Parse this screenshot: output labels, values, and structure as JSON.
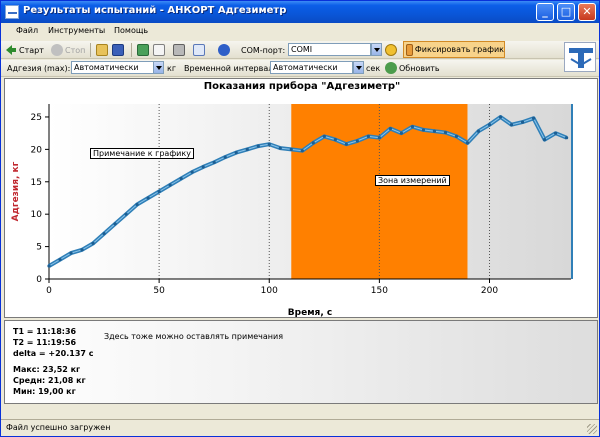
{
  "window": {
    "title": "Результаты испытаний - АНКОРТ Адгезиметр",
    "minimize": "_",
    "maximize": "□",
    "close": "✕"
  },
  "menu": [
    "Файл",
    "Инструменты",
    "Помощь"
  ],
  "toolbar": {
    "start_label": "Старт",
    "stop_label": "Стоп",
    "com_port_label": "COM-порт:",
    "com_port_value": "COMI",
    "fix_graph_label": "Фиксировать график"
  },
  "toolbar2": {
    "adhesion_label": "Адгезия (max):",
    "adhesion_value": "Автоматически",
    "adhesion_unit": "кг",
    "interval_label": "Временной интервал:",
    "interval_value": "Автоматически",
    "interval_unit": "сек",
    "refresh_label": "Обновить"
  },
  "chart": {
    "title": "Показания прибора \"Адгезиметр\"",
    "note_label": "Примечание к графику",
    "zone_label": "Зона измерений"
  },
  "chart_data": {
    "type": "line",
    "xlabel": "Время, с",
    "ylabel": "Адгезия, кг",
    "xlim": [
      0,
      237
    ],
    "ylim": [
      0,
      27
    ],
    "x_ticks": [
      0,
      50,
      100,
      150,
      200
    ],
    "y_ticks": [
      0,
      5,
      10,
      15,
      20,
      25
    ],
    "highlight_range": [
      110,
      190
    ],
    "series": [
      {
        "x": [
          0,
          5,
          10,
          15,
          20,
          25,
          30,
          35,
          40,
          45,
          50,
          55,
          60,
          65,
          70,
          75,
          80,
          85,
          90,
          95,
          100,
          105,
          110,
          115,
          120,
          125,
          130,
          135,
          140,
          145,
          150,
          155,
          160,
          165,
          170,
          175,
          180,
          185,
          190,
          195,
          200,
          205,
          210,
          215,
          220,
          225,
          230,
          235
        ],
        "values": [
          2.0,
          3.0,
          4.0,
          4.5,
          5.5,
          7.0,
          8.5,
          10.0,
          11.5,
          12.5,
          13.5,
          14.5,
          15.5,
          16.5,
          17.3,
          18.0,
          18.8,
          19.5,
          20.0,
          20.5,
          20.8,
          20.2,
          20.0,
          19.8,
          21.0,
          22.0,
          21.5,
          20.8,
          21.3,
          22.0,
          21.8,
          23.2,
          22.5,
          23.5,
          23.0,
          22.8,
          22.6,
          22.0,
          21.0,
          22.8,
          23.8,
          25.0,
          23.8,
          24.2,
          24.8,
          21.5,
          22.5,
          21.8
        ]
      }
    ]
  },
  "info": {
    "t1": "T1 = 11:18:36",
    "t2": "T2 = 11:19:56",
    "delta": "delta = +20.137 с",
    "max": "Макс: 23,52 кг",
    "avg": "Средн: 21,08 кг",
    "min": "Мин: 19,00 кг",
    "note": "Здесь тоже можно оставлять примечания"
  },
  "status": {
    "text": "Файл успешно загружен"
  }
}
